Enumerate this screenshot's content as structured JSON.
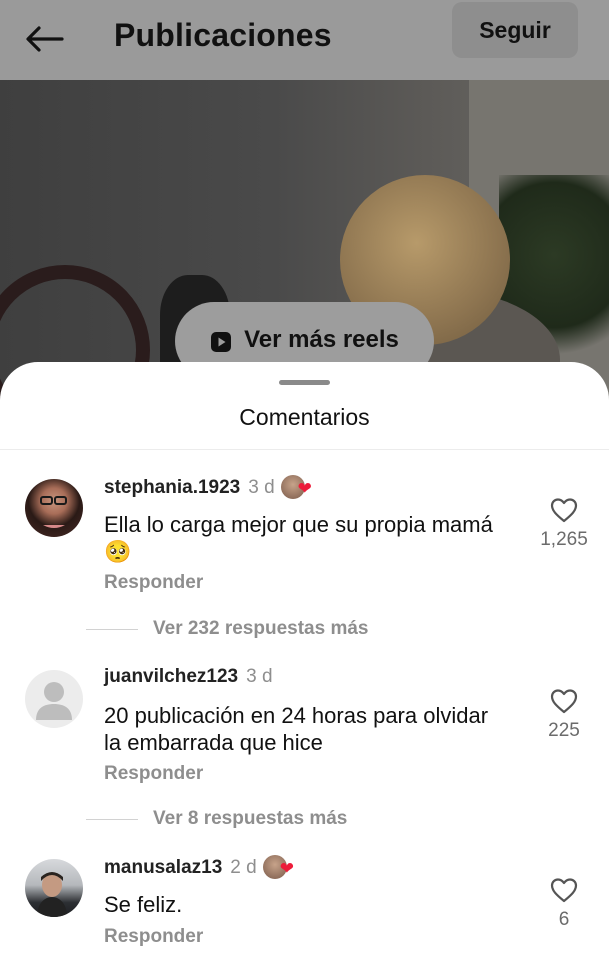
{
  "header": {
    "title": "Publicaciones",
    "follow_label": "Seguir"
  },
  "video": {
    "reels_label": "Ver más reels"
  },
  "comments_sheet": {
    "title": "Comentarios",
    "reply_label": "Responder",
    "comments": [
      {
        "username": "stephania.1923",
        "time": "3 d",
        "creator_liked": true,
        "text": "Ella lo carga mejor que su propia mamá 🥺",
        "likes": "1,265",
        "more_replies": "Ver 232 respuestas más"
      },
      {
        "username": "juanvilchez123",
        "time": "3 d",
        "creator_liked": false,
        "text": "20 publicación en 24 horas para olvidar la embarrada que hice",
        "likes": "225",
        "more_replies": "Ver 8 respuestas más"
      },
      {
        "username": "manusalaz13",
        "time": "2 d",
        "creator_liked": true,
        "text": "Se feliz.",
        "likes": "6"
      }
    ]
  },
  "colors": {
    "heart_red": "#ed1c3a",
    "secondary_text": "#8e8e8e"
  },
  "icons": [
    "back-arrow-icon",
    "reels-icon",
    "heart-outline-icon",
    "red-heart-icon"
  ]
}
